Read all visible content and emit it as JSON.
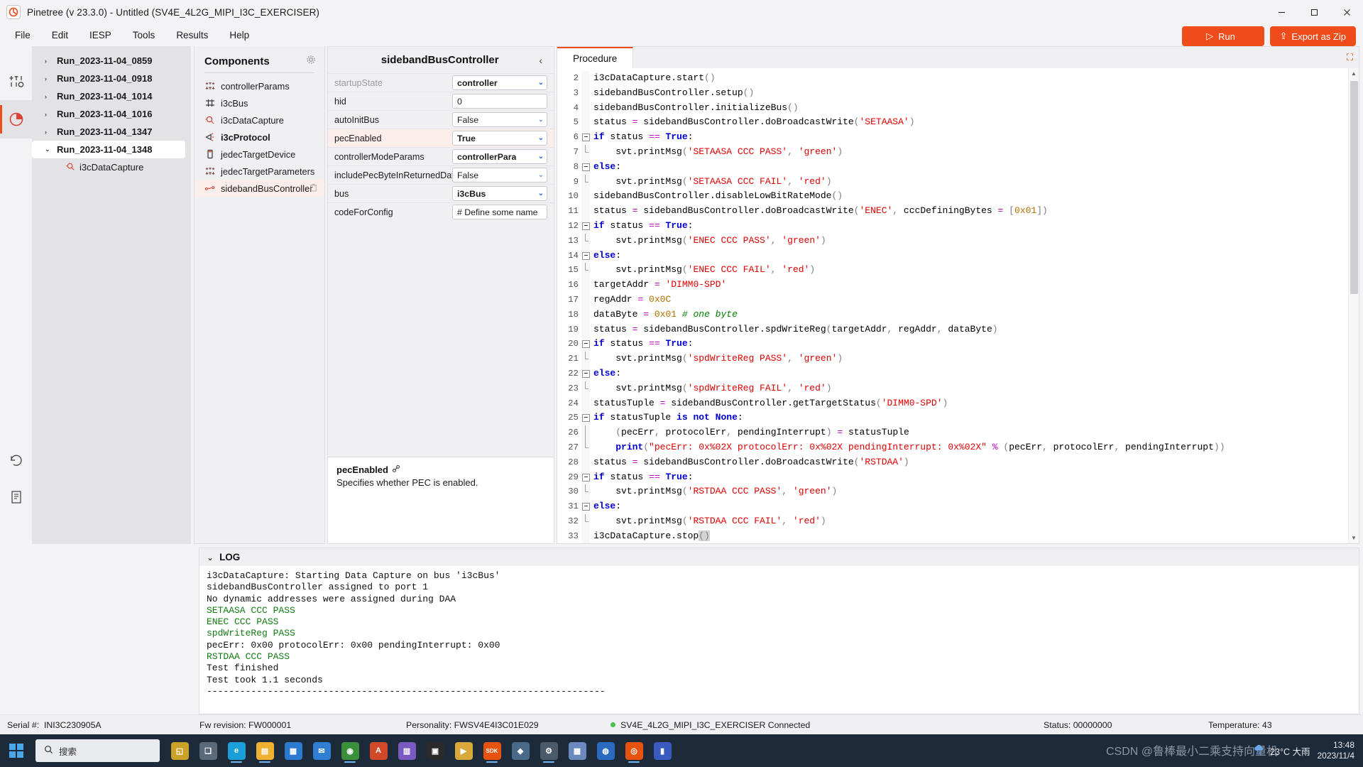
{
  "window": {
    "title": "Pinetree (v 23.3.0) - Untitled (SV4E_4L2G_MIPI_I3C_EXERCISER)",
    "logo_icon": "pinetree-logo-icon",
    "minimize": "—",
    "maximize": "▢",
    "close": "✕"
  },
  "menubar": {
    "items": [
      "File",
      "Edit",
      "IESP",
      "Tools",
      "Results",
      "Help"
    ],
    "run_label": "Run",
    "run_icon": "play-icon",
    "export_label": "Export as Zip",
    "export_icon": "upload-icon",
    "accent": "#ee4c1a"
  },
  "rail": {
    "items": [
      {
        "name": "instrument-icon",
        "glyph": "⊺⊥"
      },
      {
        "name": "results-chart-icon",
        "glyph": "◔"
      }
    ],
    "bottom": [
      {
        "name": "refresh-icon",
        "glyph": "⟳"
      },
      {
        "name": "report-icon",
        "glyph": "▤"
      }
    ]
  },
  "runs": {
    "items": [
      {
        "label": "Run_2023-11-04_0859",
        "expanded": false,
        "selected": false
      },
      {
        "label": "Run_2023-11-04_0918",
        "expanded": false,
        "selected": false
      },
      {
        "label": "Run_2023-11-04_1014",
        "expanded": false,
        "selected": false
      },
      {
        "label": "Run_2023-11-04_1016",
        "expanded": false,
        "selected": false
      },
      {
        "label": "Run_2023-11-04_1347",
        "expanded": false,
        "selected": false
      },
      {
        "label": "Run_2023-11-04_1348",
        "expanded": true,
        "selected": true
      }
    ],
    "child": {
      "label": "i3cDataCapture",
      "icon": "capture-icon"
    },
    "chevron_collapsed": "›",
    "chevron_expanded": "⌄"
  },
  "components": {
    "title": "Components",
    "gear_icon": "gear-icon",
    "items": [
      {
        "label": "controllerParams",
        "icon": "sliders-icon",
        "bold": false,
        "selected": false
      },
      {
        "label": "i3cBus",
        "icon": "bus-icon",
        "bold": false,
        "selected": false
      },
      {
        "label": "i3cDataCapture",
        "icon": "capture-icon",
        "bold": false,
        "selected": false
      },
      {
        "label": "i3cProtocol",
        "icon": "protocol-icon",
        "bold": true,
        "selected": false
      },
      {
        "label": "jedecTargetDevice",
        "icon": "device-icon",
        "bold": false,
        "selected": false
      },
      {
        "label": "jedecTargetParameters",
        "icon": "sliders-icon",
        "bold": false,
        "selected": false
      },
      {
        "label": "sidebandBusController",
        "icon": "sideband-icon",
        "bold": false,
        "selected": true,
        "trash_icon": "trash-icon"
      }
    ]
  },
  "properties": {
    "title": "sidebandBusController",
    "collapse_icon": "chevron-left-icon",
    "rows": [
      {
        "name": "startupState",
        "value": "controller",
        "type": "select",
        "dim": true,
        "bold": true,
        "selected": false
      },
      {
        "name": "hid",
        "value": "0",
        "type": "text",
        "dim": false,
        "bold": false,
        "selected": false
      },
      {
        "name": "autoInitBus",
        "value": "False",
        "type": "select",
        "dim": false,
        "bold": false,
        "selected": false
      },
      {
        "name": "pecEnabled",
        "value": "True",
        "type": "select",
        "dim": false,
        "bold": true,
        "selected": true
      },
      {
        "name": "controllerModeParams",
        "value": "controllerPara",
        "type": "select",
        "dim": false,
        "bold": true,
        "selected": false
      },
      {
        "name": "includePecByteInReturnedDat",
        "value": "False",
        "type": "select",
        "dim": false,
        "bold": false,
        "selected": false
      },
      {
        "name": "bus",
        "value": "i3cBus",
        "type": "select",
        "dim": false,
        "bold": true,
        "selected": false
      },
      {
        "name": "codeForConfig",
        "value": "# Define some name",
        "type": "text",
        "dim": false,
        "bold": false,
        "selected": false
      }
    ],
    "description": {
      "title": "pecEnabled",
      "link_icon": "link-icon",
      "text": "Specifies whether PEC is enabled."
    }
  },
  "editor": {
    "tab_label": "Procedure",
    "expand_icon": "expand-icon",
    "scroll_up": "▲",
    "scroll_down": "▼",
    "lines": [
      {
        "n": "2",
        "fold": "",
        "text": "i3cDataCapture.start()"
      },
      {
        "n": "3",
        "fold": "",
        "text": "sidebandBusController.setup()"
      },
      {
        "n": "4",
        "fold": "",
        "text": "sidebandBusController.initializeBus()"
      },
      {
        "n": "5",
        "fold": "",
        "text": "status = sidebandBusController.doBroadcastWrite('SETAASA')"
      },
      {
        "n": "6",
        "fold": "box",
        "text": "if status == True:"
      },
      {
        "n": "7",
        "fold": "end",
        "text": "    svt.printMsg('SETAASA CCC PASS', 'green')"
      },
      {
        "n": "8",
        "fold": "box",
        "text": "else:"
      },
      {
        "n": "9",
        "fold": "end",
        "text": "    svt.printMsg('SETAASA CCC FAIL', 'red')"
      },
      {
        "n": "10",
        "fold": "",
        "text": "sidebandBusController.disableLowBitRateMode()"
      },
      {
        "n": "11",
        "fold": "",
        "text": "status = sidebandBusController.doBroadcastWrite('ENEC', cccDefiningBytes = [0x01])"
      },
      {
        "n": "12",
        "fold": "box",
        "text": "if status == True:"
      },
      {
        "n": "13",
        "fold": "end",
        "text": "    svt.printMsg('ENEC CCC PASS', 'green')"
      },
      {
        "n": "14",
        "fold": "box",
        "text": "else:"
      },
      {
        "n": "15",
        "fold": "end",
        "text": "    svt.printMsg('ENEC CCC FAIL', 'red')"
      },
      {
        "n": "16",
        "fold": "",
        "text": "targetAddr = 'DIMM0-SPD'"
      },
      {
        "n": "17",
        "fold": "",
        "text": "regAddr = 0x0C"
      },
      {
        "n": "18",
        "fold": "",
        "text": "dataByte = 0x01 # one byte"
      },
      {
        "n": "19",
        "fold": "",
        "text": "status = sidebandBusController.spdWriteReg(targetAddr, regAddr, dataByte)"
      },
      {
        "n": "20",
        "fold": "box",
        "text": "if status == True:"
      },
      {
        "n": "21",
        "fold": "end",
        "text": "    svt.printMsg('spdWriteReg PASS', 'green')"
      },
      {
        "n": "22",
        "fold": "box",
        "text": "else:"
      },
      {
        "n": "23",
        "fold": "end",
        "text": "    svt.printMsg('spdWriteReg FAIL', 'red')"
      },
      {
        "n": "24",
        "fold": "",
        "text": "statusTuple = sidebandBusController.getTargetStatus('DIMM0-SPD')"
      },
      {
        "n": "25",
        "fold": "box",
        "text": "if statusTuple is not None:"
      },
      {
        "n": "26",
        "fold": "bar",
        "text": "    (pecErr, protocolErr, pendingInterrupt) = statusTuple"
      },
      {
        "n": "27",
        "fold": "end",
        "text": "    print(\"pecErr: 0x%02X protocolErr: 0x%02X pendingInterrupt: 0x%02X\" % (pecErr, protocolErr, pendingInterrupt))"
      },
      {
        "n": "28",
        "fold": "",
        "text": "status = sidebandBusController.doBroadcastWrite('RSTDAA')"
      },
      {
        "n": "29",
        "fold": "box",
        "text": "if status == True:"
      },
      {
        "n": "30",
        "fold": "end",
        "text": "    svt.printMsg('RSTDAA CCC PASS', 'green')"
      },
      {
        "n": "31",
        "fold": "box",
        "text": "else:"
      },
      {
        "n": "32",
        "fold": "end",
        "text": "    svt.printMsg('RSTDAA CCC FAIL', 'red')"
      },
      {
        "n": "33",
        "fold": "",
        "text": "i3cDataCapture.stop()"
      }
    ]
  },
  "log": {
    "title": "LOG",
    "collapse_icon": "chevron-down-icon",
    "lines": [
      {
        "text": "i3cDataCapture: Starting Data Capture on bus 'i3cBus'",
        "color": "default"
      },
      {
        "text": "sidebandBusController assigned to port 1",
        "color": "default"
      },
      {
        "text": "No dynamic addresses were assigned during DAA",
        "color": "default"
      },
      {
        "text": "SETAASA CCC PASS",
        "color": "green"
      },
      {
        "text": "ENEC CCC PASS",
        "color": "green"
      },
      {
        "text": "spdWriteReg PASS",
        "color": "green"
      },
      {
        "text": "pecErr: 0x00 protocolErr: 0x00 pendingInterrupt: 0x00",
        "color": "default"
      },
      {
        "text": "RSTDAA CCC PASS",
        "color": "green"
      },
      {
        "text": "Test finished",
        "color": "default"
      },
      {
        "text": "Test took 1.1 seconds",
        "color": "default"
      },
      {
        "text": "------------------------------------------------------------------------",
        "color": "default"
      }
    ]
  },
  "statusbar": {
    "serial_label": "Serial #:",
    "serial_value": "INI3C230905A",
    "fw": "Fw revision: FW000001",
    "personality": "Personality: FWSV4E4I3C01E029",
    "device": "SV4E_4L2G_MIPI_I3C_EXERCISER Connected",
    "device_status_color": "#48c04a",
    "status": "Status: 00000000",
    "temperature": "Temperature: 43"
  },
  "taskbar": {
    "start_icon": "windows-start-icon",
    "search_placeholder": "搜索",
    "search_icon": "search-icon",
    "icons": [
      {
        "name": "app-icon-nav",
        "glyph": "◱",
        "color": "#c9a227",
        "active": false
      },
      {
        "name": "app-icon-taskview",
        "glyph": "❏",
        "color": "#5a6a7a",
        "active": false
      },
      {
        "name": "app-icon-edge",
        "glyph": "e",
        "color": "#1a9fd8",
        "active": true
      },
      {
        "name": "app-icon-explorer",
        "glyph": "▤",
        "color": "#f0b030",
        "active": true
      },
      {
        "name": "app-icon-store",
        "glyph": "▦",
        "color": "#2a7ad0",
        "active": false
      },
      {
        "name": "app-icon-mail",
        "glyph": "✉",
        "color": "#2e7fd4",
        "active": false
      },
      {
        "name": "app-icon-chrome",
        "glyph": "◉",
        "color": "#3a8f3a",
        "active": true
      },
      {
        "name": "app-icon-adobe",
        "glyph": "A",
        "color": "#d04a2a",
        "active": false
      },
      {
        "name": "app-icon-notepad",
        "glyph": "▥",
        "color": "#7a5ac0",
        "active": false
      },
      {
        "name": "app-icon-terminal",
        "glyph": "▣",
        "color": "#2a2a2a",
        "active": false
      },
      {
        "name": "app-icon-python",
        "glyph": "▶",
        "color": "#d8a83a",
        "active": false
      },
      {
        "name": "app-icon-sdk",
        "glyph": "SDK",
        "color": "#e8520f",
        "active": true
      },
      {
        "name": "app-icon-tool",
        "glyph": "◆",
        "color": "#4a6a8a",
        "active": false
      },
      {
        "name": "app-icon-settings",
        "glyph": "⚙",
        "color": "#4a5a6a",
        "active": true
      },
      {
        "name": "app-icon-grid",
        "glyph": "▦",
        "color": "#6a8ac0",
        "active": false
      },
      {
        "name": "app-icon-browser",
        "glyph": "◍",
        "color": "#2a6ac0",
        "active": false
      },
      {
        "name": "app-icon-pinetree",
        "glyph": "◎",
        "color": "#e8520f",
        "active": true
      },
      {
        "name": "app-icon-chart",
        "glyph": "▮",
        "color": "#3a5ac0",
        "active": false
      }
    ],
    "tray_weather_icon": "rain-icon",
    "tray_weather": "23°C 大雨",
    "tray_time": "13:48",
    "tray_date": "2023/11/4",
    "watermark": "CSDN @鲁棒最小二乘支持向量机"
  }
}
